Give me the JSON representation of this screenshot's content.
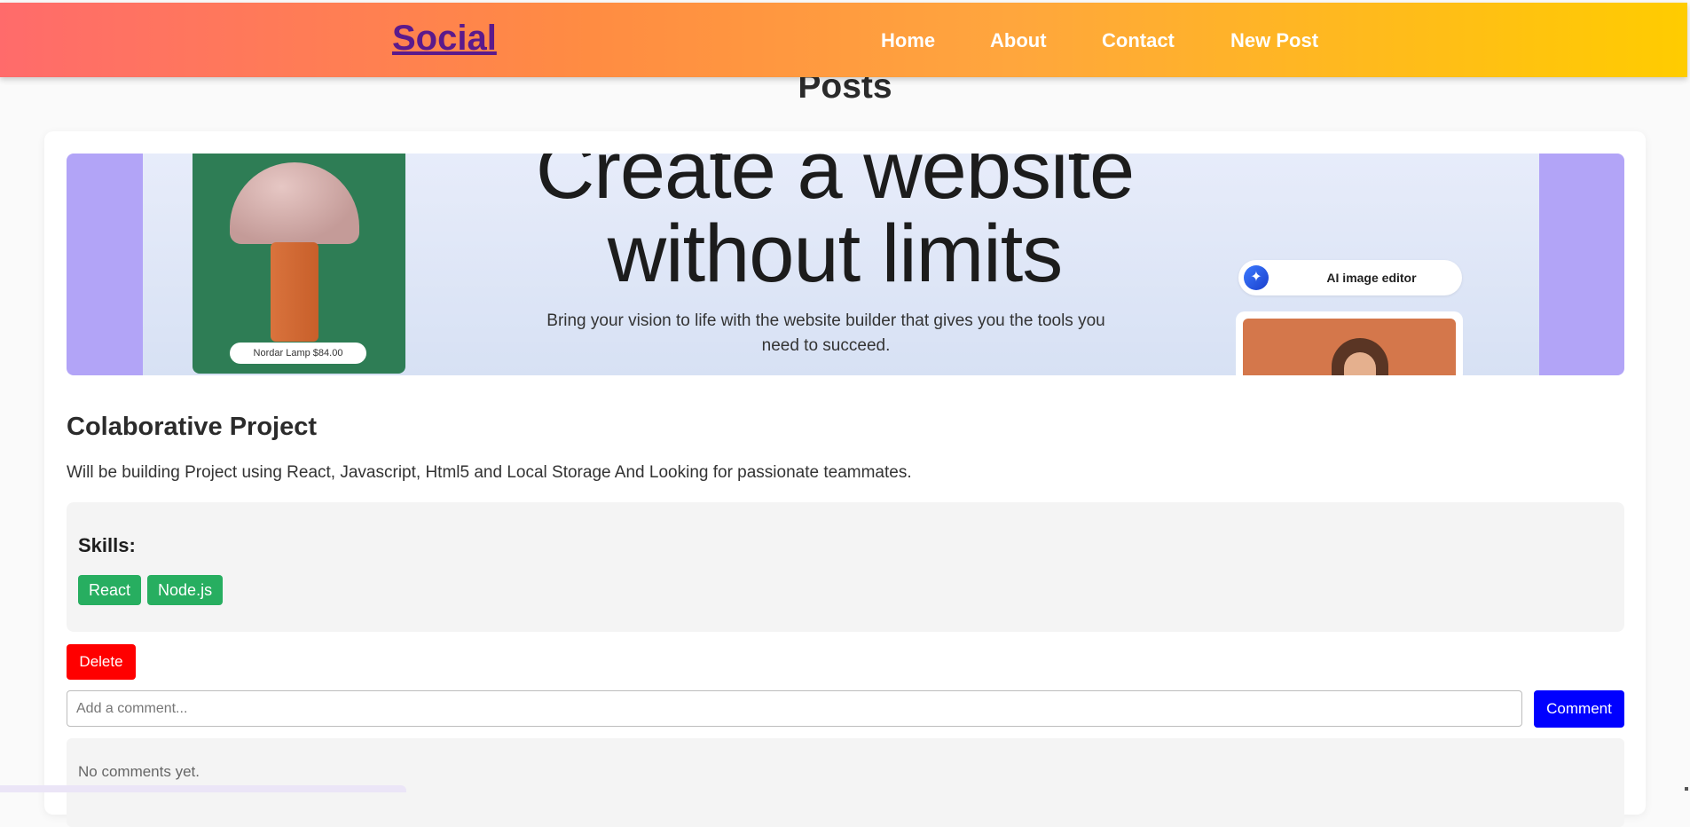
{
  "navbar": {
    "brand": "Social",
    "links": [
      {
        "label": "Home"
      },
      {
        "label": "About"
      },
      {
        "label": "Contact"
      },
      {
        "label": "New Post"
      }
    ],
    "gradient": [
      "#ff6b6b",
      "#ff8c42",
      "#ffa63d",
      "#ffcc00"
    ]
  },
  "page": {
    "title": "Posts"
  },
  "post": {
    "banner": {
      "headline": "Create a website without limits",
      "subtext": "Bring your vision to life with the website builder that gives you the tools you need to succeed.",
      "lamp_tag": "Nordar Lamp $84.00",
      "ai_label": "AI image editor"
    },
    "title": "Colaborative Project",
    "description": "Will be building Project using React, Javascript, Html5 and Local Storage And Looking for passionate teammates.",
    "skills_label": "Skills:",
    "skills": [
      "React",
      "Node.js"
    ],
    "delete_label": "Delete",
    "comment_placeholder": "Add a comment...",
    "comment_button": "Comment",
    "no_comments": "No comments yet."
  },
  "colors": {
    "skill_tag": "#27ae60",
    "delete": "#ff0000",
    "comment_button": "#0000ff",
    "brand": "#5b1a8c"
  }
}
